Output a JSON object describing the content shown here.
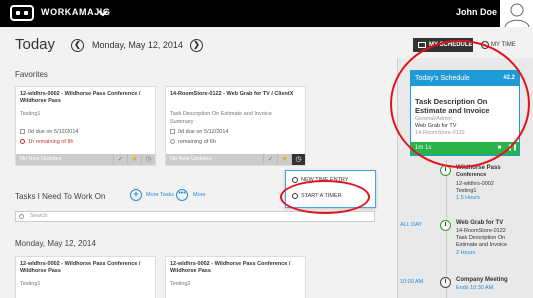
{
  "topbar": {
    "brand": "WORKAMAJIG",
    "user_name": "John Doe"
  },
  "header": {
    "title": "Today",
    "prev_glyph": "❮",
    "next_glyph": "❯",
    "date": "Monday, May 12, 2014",
    "my_schedule": "MY SCHEDULE",
    "my_time": "MY TIME"
  },
  "favorites": {
    "title": "Favorites",
    "cards": [
      {
        "title": "12-wldhrs-0002 - Wildhorse Pass Conference / Wildhorse Pass",
        "sub": "Testing1",
        "due": "0d",
        "due_word": "due on",
        "due_date": "5/12/2014",
        "remaining": "1h remaining of 8h",
        "footer": "No New Updates"
      },
      {
        "title": "14-RoomStore-0122 - Web Grab for TV / ClientX",
        "sub": "Task Description On Estimate and Invoice",
        "sub2": "Summary",
        "due": "0d",
        "due_word": "due on",
        "due_date": "5/12/2014",
        "remaining": "remaining of 6h",
        "footer": "No New Updates"
      }
    ]
  },
  "popup": {
    "new_time_entry": "NEW TIME ENTRY",
    "start_timer": "START A TIMER"
  },
  "tasks": {
    "title": "Tasks I Need To Work On",
    "more_tasks": "More Tasks",
    "more": "More",
    "search_placeholder": "Search"
  },
  "day_section": {
    "title": "Monday, May 12, 2014",
    "cards": [
      {
        "title": "12-wldhrs-0002 - Wildhorse Pass Conference / Wildhorse Pass",
        "sub": "Testing1"
      },
      {
        "title": "12-wldhrs-0002 - Wildhorse Pass Conference / Wildhorse Pass",
        "sub": "Testing2"
      }
    ]
  },
  "schedule": {
    "head": "Today's Schedule",
    "count": "#2.2",
    "title": "Task Description On Estimate and Invoice",
    "sub1": "General/Admin",
    "sub2": "Web Grab for TV",
    "sub3": "14-RoomStore-0122",
    "timer": "1m 1s"
  },
  "timeline": [
    {
      "side": "",
      "t1": "Wildhorse Pass",
      "t2": "Conference",
      "t3a": "12-wldhrs-0002",
      "t3b": "Testing1",
      "t4": "1.5 Hours"
    },
    {
      "side": "ALL DAY",
      "t1": "Web Grab for TV",
      "t2": "14-RoomStore-0122",
      "t3a": "Task Description On",
      "t3b": "Estimate and Invoice",
      "t4": "2 Hours"
    },
    {
      "side": "10:00 AM",
      "t1": "Company Meeting",
      "t2": "Ends 10:30 AM"
    }
  ],
  "colors": {
    "accent": "#1e9bd7",
    "green": "#2ab34a",
    "annotation": "#e0141e",
    "topbar": "#000000"
  }
}
